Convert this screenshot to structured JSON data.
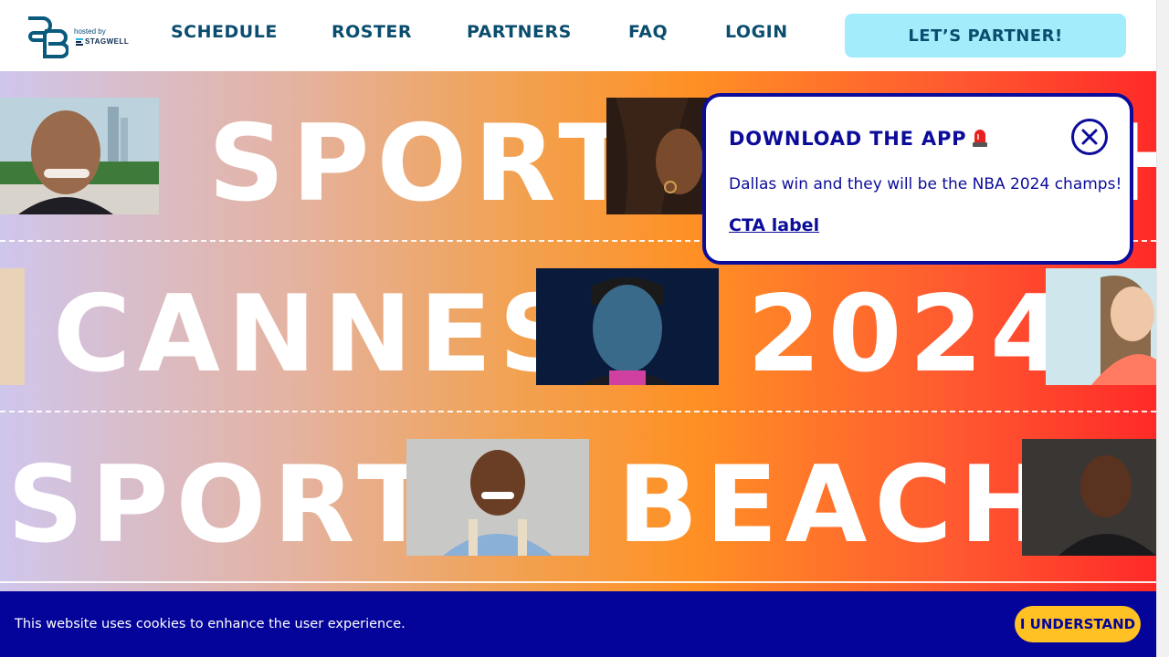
{
  "header": {
    "logo_letters": "SB",
    "hosted_by": "hosted by",
    "host_brand": "STAGWELL",
    "nav": [
      "SCHEDULE",
      "ROSTER",
      "PARTNERS",
      "FAQ",
      "LOGIN"
    ],
    "cta": "LET’S PARTNER!"
  },
  "hero": {
    "row1": [
      "SPORT",
      "H"
    ],
    "row2": [
      "CANNES",
      "2024"
    ],
    "row3": [
      "SPORT",
      "BEACH"
    ]
  },
  "popup": {
    "title": "DOWNLOAD THE APP",
    "message": "Dallas win and they will be the NBA 2024 champs!",
    "link": "CTA label"
  },
  "cookie_bar": {
    "message": "This website uses cookies to enhance the user experience.",
    "button": "I UNDERSTAND"
  },
  "colors": {
    "brand_navy": "#0c0c9a",
    "brand_teal": "#0a4d6e",
    "cta_bg": "#a3ecfb",
    "cookie_btn": "#ffc123"
  }
}
